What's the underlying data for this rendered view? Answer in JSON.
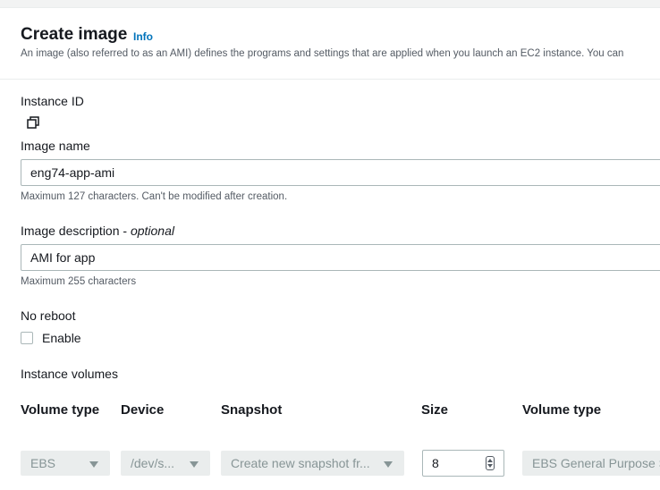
{
  "header": {
    "title": "Create image",
    "info_link": "Info",
    "description": "An image (also referred to as an AMI) defines the programs and settings that are applied when you launch an EC2 instance. You can"
  },
  "instance_id": {
    "label": "Instance ID",
    "icon": "copy-icon"
  },
  "image_name": {
    "label": "Image name",
    "value": "eng74-app-ami",
    "hint": "Maximum 127 characters. Can't be modified after creation."
  },
  "image_description": {
    "label": "Image description - ",
    "label_optional": "optional",
    "value": "AMI for app",
    "hint": "Maximum 255 characters"
  },
  "no_reboot": {
    "label": "No reboot",
    "checkbox_label": "Enable",
    "checked": false
  },
  "instance_volumes": {
    "label": "Instance volumes",
    "columns": [
      "Volume type",
      "Device",
      "Snapshot",
      "Size",
      "Volume type"
    ],
    "row": {
      "volume_type": "EBS",
      "device": "/dev/s...",
      "snapshot": "Create new snapshot fr...",
      "size": "8",
      "ebs_volume_type": "EBS General Purpose S"
    }
  },
  "colors": {
    "accent_link": "#0073bb",
    "text": "#16191f",
    "muted": "#545b64",
    "border": "#aab7b8",
    "disabled_bg": "#eaeded"
  }
}
